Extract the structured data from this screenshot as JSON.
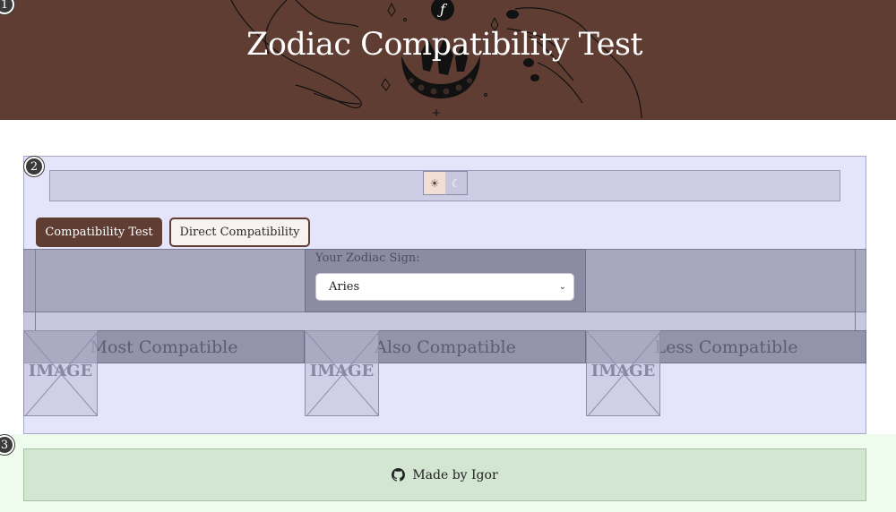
{
  "header": {
    "title": "Zodiac Compatibility Test"
  },
  "markers": [
    "1",
    "2",
    "3"
  ],
  "theme_toggle": {
    "light_icon": "sun-icon",
    "dark_icon": "moon-icon",
    "light_glyph": "☀",
    "dark_glyph": "☾"
  },
  "tabs": [
    {
      "label": "Compatibility Test",
      "active": true
    },
    {
      "label": "Direct Compatibility",
      "active": false
    }
  ],
  "sign_select": {
    "label": "Your Zodiac Sign:",
    "value": "Aries"
  },
  "columns": [
    {
      "heading": "Most Compatible",
      "image_text": "IMAGE"
    },
    {
      "heading": "Also Compatible",
      "image_text": "IMAGE"
    },
    {
      "heading": "Less Compatible",
      "image_text": "IMAGE"
    }
  ],
  "footer": {
    "text": "Made by Igor",
    "icon": "github-icon"
  },
  "colors": {
    "brand_brown": "#5f3d33",
    "overlay_blue": "#e4e4fb",
    "footer_green": "#d3e6d2"
  }
}
